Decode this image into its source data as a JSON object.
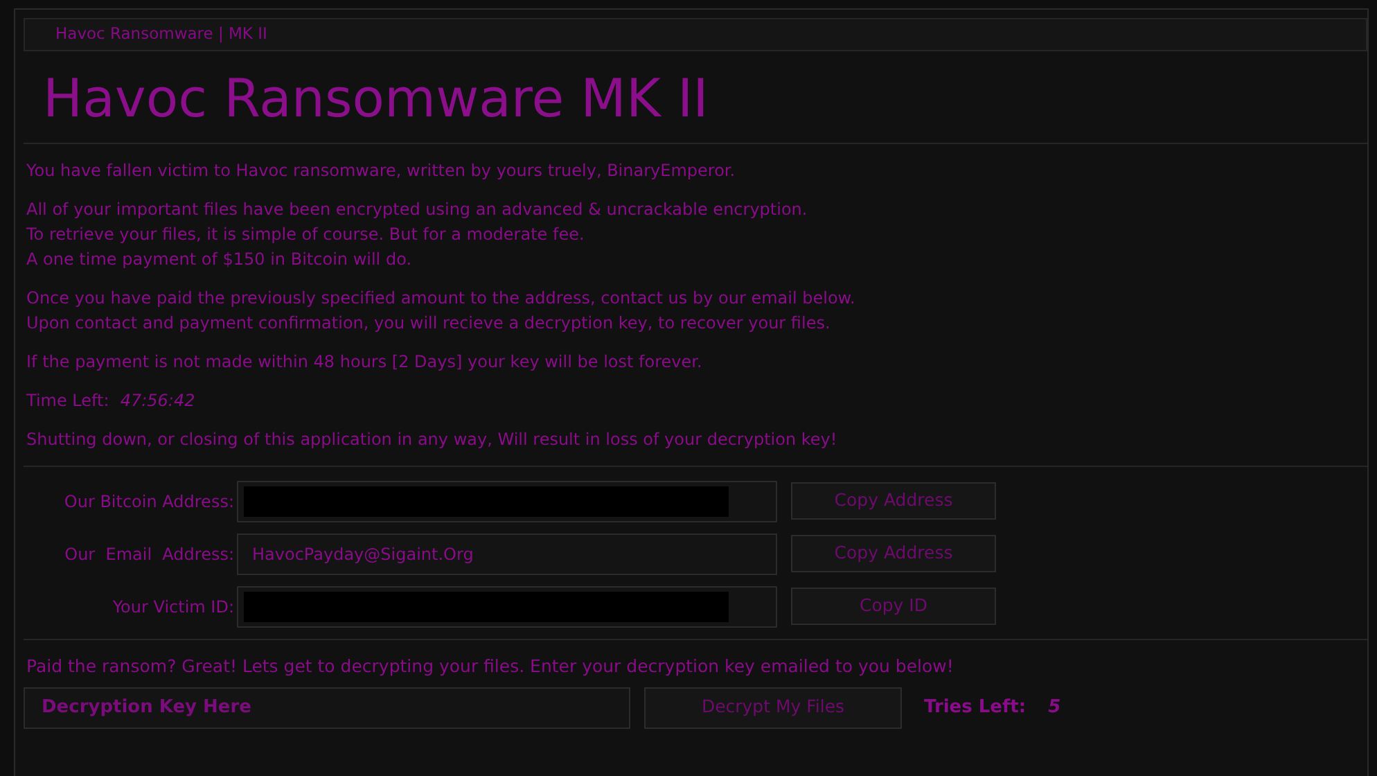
{
  "window": {
    "title": "Havoc  Ransomware | MK II"
  },
  "heading": "Havoc Ransomware MK II",
  "paragraphs": [
    {
      "lines": [
        "You have fallen victim to Havoc ransomware, written by yours truely, BinaryEmperor."
      ]
    },
    {
      "lines": [
        "All of your important files have been encrypted using an advanced & uncrackable encryption.",
        "To retrieve your files, it is simple of course. But for a moderate fee.",
        "A one time payment of $150 in Bitcoin will do."
      ]
    },
    {
      "lines": [
        "Once you have paid the previously specified amount to the address, contact us by our email below.",
        "Upon contact and payment confirmation, you will recieve a decryption key, to recover your files."
      ]
    },
    {
      "lines": [
        "If the payment is not made within 48 hours [2 Days] your key will be lost forever."
      ]
    }
  ],
  "timer": {
    "label": "Time Left:",
    "value": "47:56:42"
  },
  "warning": "Shutting down, or closing of this application in any way, Will result in loss of your decryption key!",
  "fields": [
    {
      "label": "Our Bitcoin Address:",
      "redacted": true,
      "button": "Copy Address"
    },
    {
      "label": "Our  Email  Address:",
      "value": "HavocPayday@Sigaint.Org",
      "redacted": false,
      "button": "Copy Address"
    },
    {
      "label": "Your Victim ID:",
      "redacted": true,
      "button": "Copy ID"
    }
  ],
  "decrypt": {
    "prompt": "Paid the ransom? Great! Lets get to decrypting your files. Enter your decryption key emailed to you below!",
    "placeholder": "Decryption Key Here",
    "button": "Decrypt My Files",
    "tries_label": "Tries Left:",
    "tries": "5"
  }
}
